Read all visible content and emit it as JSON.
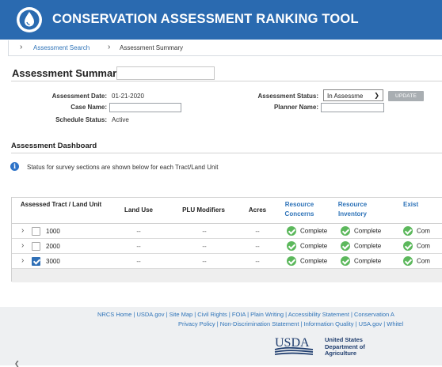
{
  "header": {
    "title": "CONSERVATION ASSESSMENT RANKING TOOL",
    "logo_icon": "water-drop-icon"
  },
  "breadcrumb": {
    "link": "Assessment Search",
    "current": "Assessment Summary"
  },
  "summary": {
    "title": "Assessment Summary:",
    "name_value": ""
  },
  "details": {
    "date_label": "Assessment Date:",
    "date_value": "01-21-2020",
    "case_label": "Case Name:",
    "case_value": "",
    "schedule_label": "Schedule Status:",
    "schedule_value": "Active",
    "status_label": "Assessment Status:",
    "status_value": "In Assessme",
    "planner_label": "Planner Name:",
    "planner_value": "",
    "update_button": "UPDATE"
  },
  "dashboard": {
    "title": "Assessment Dashboard",
    "info": "Status for survey sections are shown below for each Tract/Land Unit",
    "columns": [
      "Assessed Tract / Land Unit",
      "Land Use",
      "PLU Modifiers",
      "Acres",
      "Resource Concerns",
      "Resource Inventory",
      "Exist Practi"
    ],
    "rows": [
      {
        "tract": "1000",
        "checked": false,
        "land_use": "--",
        "plu": "--",
        "acres": "--",
        "rc": "Complete",
        "ri": "Complete",
        "ep": "Com"
      },
      {
        "tract": "2000",
        "checked": false,
        "land_use": "--",
        "plu": "--",
        "acres": "--",
        "rc": "Complete",
        "ri": "Complete",
        "ep": "Com"
      },
      {
        "tract": "3000",
        "checked": true,
        "land_use": "--",
        "plu": "--",
        "acres": "--",
        "rc": "Complete",
        "ri": "Complete",
        "ep": "Com"
      }
    ]
  },
  "footer": {
    "line1": "NRCS Home | USDA.gov | Site Map | Civil Rights | FOIA | Plain Writing | Accessibility Statement | Conservation A",
    "line2": "Privacy Policy | Non-Discrimination Statement | Information Quality | USA.gov | Whitel",
    "usda_logo": "USDA",
    "usda_line1": "United States",
    "usda_line2": "Department of",
    "usda_line3": "Agriculture"
  },
  "colors": {
    "header": "#2a6ab0",
    "link": "#2e73b8",
    "complete": "#5cb85c",
    "checkbox": "#2f6fb6"
  }
}
